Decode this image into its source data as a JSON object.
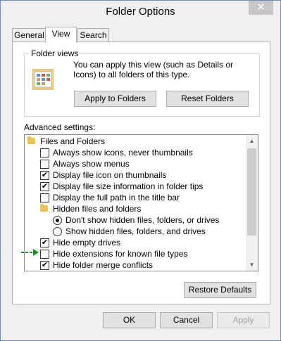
{
  "window": {
    "title": "Folder Options",
    "close_glyph": "✕"
  },
  "tabs": [
    {
      "label": "General",
      "active": false
    },
    {
      "label": "View",
      "active": true
    },
    {
      "label": "Search",
      "active": false
    }
  ],
  "folder_views": {
    "group_label": "Folder views",
    "description": "You can apply this view (such as Details or Icons) to all folders of this type.",
    "apply_button": "Apply to Folders",
    "reset_button": "Reset Folders",
    "icon": "folder-views-icon"
  },
  "advanced": {
    "label": "Advanced settings:",
    "items": [
      {
        "type": "folder",
        "label": "Files and Folders",
        "level": 0
      },
      {
        "type": "checkbox",
        "label": "Always show icons, never thumbnails",
        "checked": false,
        "level": 1
      },
      {
        "type": "checkbox",
        "label": "Always show menus",
        "checked": false,
        "level": 1
      },
      {
        "type": "checkbox",
        "label": "Display file icon on thumbnails",
        "checked": true,
        "level": 1
      },
      {
        "type": "checkbox",
        "label": "Display file size information in folder tips",
        "checked": true,
        "level": 1
      },
      {
        "type": "checkbox",
        "label": "Display the full path in the title bar",
        "checked": false,
        "level": 1
      },
      {
        "type": "folder",
        "label": "Hidden files and folders",
        "level": 1
      },
      {
        "type": "radio",
        "label": "Don't show hidden files, folders, or drives",
        "checked": true,
        "level": 2
      },
      {
        "type": "radio",
        "label": "Show hidden files, folders, and drives",
        "checked": false,
        "level": 2
      },
      {
        "type": "checkbox",
        "label": "Hide empty drives",
        "checked": true,
        "level": 1
      },
      {
        "type": "checkbox",
        "label": "Hide extensions for known file types",
        "checked": false,
        "level": 1
      },
      {
        "type": "checkbox",
        "label": "Hide folder merge conflicts",
        "checked": true,
        "level": 1
      }
    ]
  },
  "restore_button": "Restore Defaults",
  "footer": {
    "ok": "OK",
    "cancel": "Cancel",
    "apply": "Apply"
  },
  "colors": {
    "annotation_arrow": "#1f8f1f",
    "folder": "#e9c25a"
  }
}
